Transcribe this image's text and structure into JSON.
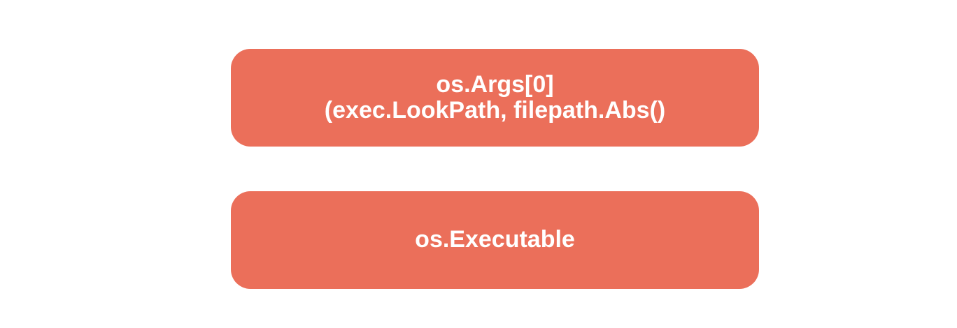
{
  "colors": {
    "background": "#ffffff",
    "box_fill": "#eb6f5a",
    "box_text": "#ffffff"
  },
  "boxes": [
    {
      "lines": [
        "os.Args[0]",
        "(exec.LookPath, filepath.Abs()"
      ]
    },
    {
      "lines": [
        "os.Executable"
      ]
    }
  ]
}
